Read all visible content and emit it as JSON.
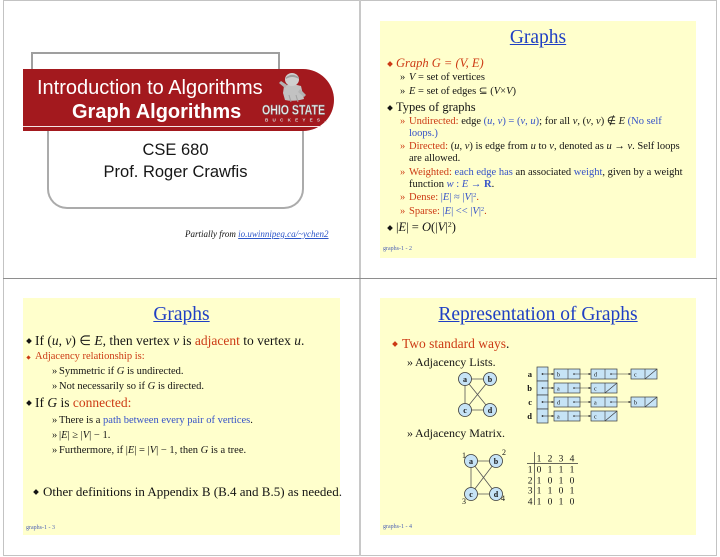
{
  "glyphs": {
    "sub_bullet": "»",
    "main_bullet_icon": "diamond-bullet"
  },
  "colors": {
    "banner": "#a3191e",
    "panel_background": "#ffffcc",
    "title": "#1f3fc4",
    "emphasis_red": "#cc3a14",
    "emphasis_blue": "#3552c8",
    "footer": "#4a5fb4"
  },
  "slide1": {
    "banner_line1": "Introduction to Algorithms",
    "banner_line2": "Graph Algorithms",
    "logo": {
      "icon": "ohio-state-buckeyes-logo",
      "wordmark": "OHIO STATE",
      "subtext": "BUCKEYES",
      "trademark": "™"
    },
    "course": "CSE 680",
    "instructor": "Prof. Roger Crawfis",
    "credit_prefix": "Partially from ",
    "credit_link": "io.uwinnipeg.ca/~ychen2"
  },
  "slide2": {
    "title": "Graphs",
    "items": [
      {
        "rows": [
          [
            {
              "t": "Graph G = (V, E)",
              "s": "red em"
            }
          ]
        ]
      },
      {
        "rows": [
          [
            {
              "t": "V",
              "s": "em"
            },
            {
              "t": " = set of vertices"
            }
          ]
        ]
      },
      {
        "rows": [
          [
            {
              "t": "E",
              "s": "em"
            },
            {
              "t": " = set of edges ⊆ ("
            },
            {
              "t": "V",
              "s": "em"
            },
            {
              "t": "×"
            },
            {
              "t": "V",
              "s": "em"
            },
            {
              "t": ")"
            }
          ]
        ]
      },
      {
        "rows": [
          [
            {
              "t": "Types of graphs"
            }
          ]
        ]
      },
      {
        "rows": [
          [
            {
              "t": "Undirected:",
              "s": "red"
            },
            {
              "t": " edge "
            },
            {
              "t": "(",
              "s": "blue"
            },
            {
              "t": "u",
              "s": "blue em"
            },
            {
              "t": ", ",
              "s": "blue"
            },
            {
              "t": "v",
              "s": "blue em"
            },
            {
              "t": ") = (",
              "s": "blue"
            },
            {
              "t": "v",
              "s": "blue em"
            },
            {
              "t": ", ",
              "s": "blue"
            },
            {
              "t": "u",
              "s": "blue em"
            },
            {
              "t": ")",
              "s": "blue"
            },
            {
              "t": "; for all "
            },
            {
              "t": "v",
              "s": "em"
            },
            {
              "t": ", ("
            },
            {
              "t": "v",
              "s": "em"
            },
            {
              "t": ", "
            },
            {
              "t": "v",
              "s": "em"
            },
            {
              "t": ") ∉ "
            },
            {
              "t": "E",
              "s": "em"
            },
            {
              "t": " "
            },
            {
              "t": "(No self",
              "s": "blue"
            }
          ],
          [
            {
              "t": "loops.)",
              "s": "blue"
            }
          ]
        ]
      },
      {
        "rows": [
          [
            {
              "t": "Directed:",
              "s": "red"
            },
            {
              "t": " ("
            },
            {
              "t": "u",
              "s": "em"
            },
            {
              "t": ", "
            },
            {
              "t": "v",
              "s": "em"
            },
            {
              "t": ") is edge from "
            },
            {
              "t": "u",
              "s": "em"
            },
            {
              "t": " to "
            },
            {
              "t": "v",
              "s": "em"
            },
            {
              "t": ", denoted as "
            },
            {
              "t": "u",
              "s": "em"
            },
            {
              "t": " → "
            },
            {
              "t": "v",
              "s": "em"
            },
            {
              "t": ". Self loops"
            }
          ],
          [
            {
              "t": "are allowed."
            }
          ]
        ]
      },
      {
        "rows": [
          [
            {
              "t": "Weighted:",
              "s": "red"
            },
            {
              "t": " "
            },
            {
              "t": "each edge has",
              "s": "blue"
            },
            {
              "t": " an associated "
            },
            {
              "t": "weight",
              "s": "blue"
            },
            {
              "t": ", given by a weight"
            }
          ],
          [
            {
              "t": "function "
            },
            {
              "t": "w",
              "s": "blue em"
            },
            {
              "t": " : ",
              "s": "blue"
            },
            {
              "t": "E",
              "s": "blue em"
            },
            {
              "t": " → ",
              "s": "blue"
            },
            {
              "t": "R",
              "s": "blue b"
            },
            {
              "t": "."
            }
          ]
        ]
      },
      {
        "rows": [
          [
            {
              "t": "Dense: ",
              "s": "red"
            },
            {
              "t": "|",
              "s": "blue"
            },
            {
              "t": "E",
              "s": "blue em"
            },
            {
              "t": "| ≈ |",
              "s": "blue"
            },
            {
              "t": "V",
              "s": "blue em"
            },
            {
              "t": "|",
              "s": "blue"
            },
            {
              "t": "2",
              "s": "blue sup"
            },
            {
              "t": ".",
              "s": "red"
            }
          ]
        ]
      },
      {
        "rows": [
          [
            {
              "t": "Sparse: ",
              "s": "red"
            },
            {
              "t": "|",
              "s": "blue"
            },
            {
              "t": "E",
              "s": "blue em"
            },
            {
              "t": "| << |",
              "s": "blue"
            },
            {
              "t": "V",
              "s": "blue em"
            },
            {
              "t": "|",
              "s": "blue"
            },
            {
              "t": "2",
              "s": "blue sup"
            },
            {
              "t": ".",
              "s": "red"
            }
          ]
        ]
      },
      {
        "rows": [
          [
            {
              "t": "|"
            },
            {
              "t": "E",
              "s": "em"
            },
            {
              "t": "| = "
            },
            {
              "t": "O",
              "s": "em"
            },
            {
              "t": "(|"
            },
            {
              "t": "V",
              "s": "em"
            },
            {
              "t": "|"
            },
            {
              "t": "2",
              "s": "sup"
            },
            {
              "t": ")"
            }
          ]
        ]
      }
    ],
    "footer": "graphs-1 - 2"
  },
  "slide3": {
    "title": "Graphs",
    "items": [
      {
        "rows": [
          [
            {
              "t": "If ("
            },
            {
              "t": "u",
              "s": "em"
            },
            {
              "t": ", "
            },
            {
              "t": "v",
              "s": "em"
            },
            {
              "t": ") ∈ "
            },
            {
              "t": "E",
              "s": "em"
            },
            {
              "t": ", then vertex "
            },
            {
              "t": "v",
              "s": "em"
            },
            {
              "t": " is "
            },
            {
              "t": "adjacent",
              "s": "red"
            },
            {
              "t": " to vertex "
            },
            {
              "t": "u",
              "s": "em"
            },
            {
              "t": "."
            }
          ]
        ]
      },
      {
        "rows": [
          [
            {
              "t": "Adjacency relationship is:",
              "s": "red"
            }
          ]
        ]
      },
      {
        "rows": [
          [
            {
              "t": "Symmetric if "
            },
            {
              "t": "G",
              "s": "em"
            },
            {
              "t": " is undirected."
            }
          ]
        ]
      },
      {
        "rows": [
          [
            {
              "t": "Not necessarily so if "
            },
            {
              "t": "G",
              "s": "em"
            },
            {
              "t": " is directed."
            }
          ]
        ]
      },
      {
        "rows": [
          [
            {
              "t": "If "
            },
            {
              "t": "G",
              "s": "em"
            },
            {
              "t": " is "
            },
            {
              "t": "connected:",
              "s": "red"
            }
          ]
        ]
      },
      {
        "rows": [
          [
            {
              "t": "There is a "
            },
            {
              "t": "path between every pair of vertices",
              "s": "blue"
            },
            {
              "t": "."
            }
          ]
        ]
      },
      {
        "rows": [
          [
            {
              "t": "|"
            },
            {
              "t": "E",
              "s": "em"
            },
            {
              "t": "| ≥ |"
            },
            {
              "t": "V",
              "s": "em"
            },
            {
              "t": "| − 1."
            }
          ]
        ]
      },
      {
        "rows": [
          [
            {
              "t": "Furthermore, if |"
            },
            {
              "t": "E",
              "s": "em"
            },
            {
              "t": "| = |"
            },
            {
              "t": "V",
              "s": "em"
            },
            {
              "t": "| − 1, then "
            },
            {
              "t": "G",
              "s": "em"
            },
            {
              "t": " is a tree."
            }
          ]
        ]
      },
      {
        "rows": [
          [
            {
              "t": "Other definitions in Appendix B (B.4 and B.5) as needed."
            }
          ]
        ]
      }
    ],
    "footer": "graphs-1 - 3"
  },
  "slide4": {
    "title": "Representation of Graphs",
    "items": [
      {
        "rows": [
          [
            {
              "t": "Two standard ways",
              "s": "red"
            },
            {
              "t": "."
            }
          ]
        ]
      },
      {
        "rows": [
          [
            {
              "t": "Adjacency Lists."
            }
          ]
        ]
      },
      {
        "rows": [
          [
            {
              "t": "Adjacency Matrix."
            }
          ]
        ]
      }
    ],
    "graph": {
      "vertices": [
        "a",
        "b",
        "c",
        "d"
      ],
      "edges": [
        [
          "a",
          "b"
        ],
        [
          "a",
          "c"
        ],
        [
          "a",
          "d"
        ],
        [
          "b",
          "c"
        ],
        [
          "c",
          "d"
        ]
      ]
    },
    "adjacency_lists": {
      "a": [
        "b",
        "d",
        "c"
      ],
      "b": [
        "a",
        "c"
      ],
      "c": [
        "d",
        "a",
        "b"
      ],
      "d": [
        "a",
        "c"
      ]
    },
    "vertex_numbers": {
      "a": "1",
      "b": "2",
      "c": "3",
      "d": "4"
    },
    "adjacency_matrix": {
      "columns": [
        "1",
        "2",
        "3",
        "4"
      ],
      "rows": [
        {
          "label": "1",
          "values": [
            0,
            1,
            1,
            1
          ]
        },
        {
          "label": "2",
          "values": [
            1,
            0,
            1,
            0
          ]
        },
        {
          "label": "3",
          "values": [
            1,
            1,
            0,
            1
          ]
        },
        {
          "label": "4",
          "values": [
            1,
            0,
            1,
            0
          ]
        }
      ]
    },
    "footer": "graphs-1 - 4"
  }
}
